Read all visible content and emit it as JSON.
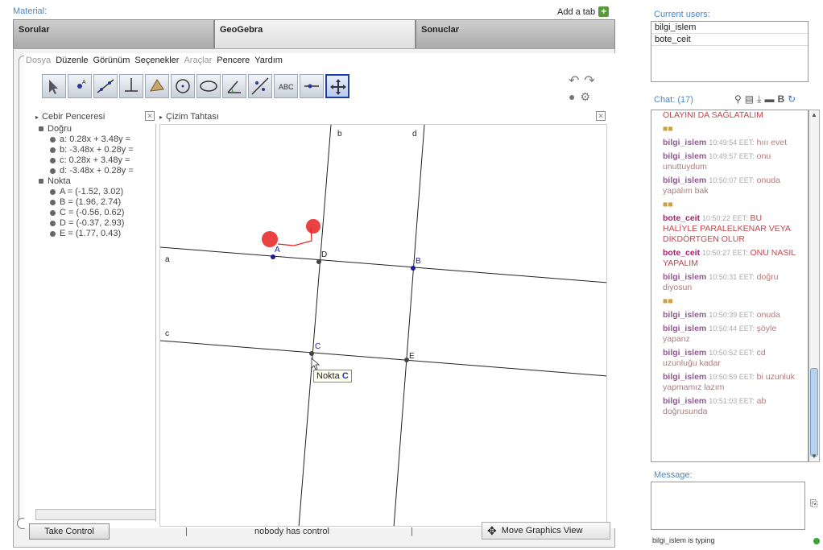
{
  "material": {
    "label": "Material:",
    "add_tab": "Add a tab",
    "tabs": [
      {
        "label": "Sorular"
      },
      {
        "label": "GeoGebra"
      },
      {
        "label": "Sonuclar"
      }
    ]
  },
  "geogebra": {
    "menu": [
      "Dosya",
      "Düzenle",
      "Görünüm",
      "Seçenekler",
      "Araçlar",
      "Pencere",
      "Yardım"
    ],
    "algebra_view": {
      "title": "Cebir Penceresi",
      "categories": [
        {
          "label": "Doğru",
          "items": [
            "a: 0.28x + 3.48y =",
            "b: -3.48x + 0.28y =",
            "c: 0.28x + 3.48y =",
            "d: -3.48x + 0.28y ="
          ]
        },
        {
          "label": "Nokta",
          "items": [
            "A = (-1.52, 3.02)",
            "B = (1.96, 2.74)",
            "C = (-0.56, 0.62)",
            "D = (-0.37, 2.93)",
            "E = (1.77, 0.43)"
          ]
        }
      ]
    },
    "graphics_view": {
      "title": "Çizim Tahtası",
      "line_labels": {
        "a": "a",
        "b": "b",
        "c": "c",
        "d": "d"
      },
      "point_labels": {
        "A": "A",
        "B": "B",
        "C": "C",
        "D": "D",
        "E": "E"
      },
      "tooltip_prefix": "Nokta",
      "tooltip_point": "C"
    },
    "status": {
      "take_control": "Take Control",
      "control_text": "nobody has control",
      "move_graphics": "Move Graphics View",
      "separator": "|"
    }
  },
  "users": {
    "label": "Current users:",
    "list": [
      "bilgi_islem",
      "bote_ceit"
    ]
  },
  "chat": {
    "label": "Chat: (17)",
    "messages": [
      {
        "type": "shout",
        "text": "OLAYINI DA SAĞLATALIM"
      },
      {
        "type": "sys",
        "text": "■■"
      },
      {
        "who": "bilgi_islem",
        "time": "10:49:54 EET:",
        "text": "hııı evet"
      },
      {
        "who": "bilgi_islem",
        "time": "10:49:57 EET:",
        "text": "onu unuttuydum"
      },
      {
        "who": "bilgi_islem",
        "time": "10:50:07 EET:",
        "text": "onuda yapalım bak"
      },
      {
        "type": "sys",
        "text": "■■"
      },
      {
        "who": "bote_ceit",
        "time": "10:50:22 EET:",
        "text": "BU HALİYLE PARALELKENAR VEYA DİKDÖRTGEN OLUR"
      },
      {
        "who": "bote_ceit",
        "time": "10:50:27 EET:",
        "text": "ONU NASIL YAPALIM"
      },
      {
        "who": "bilgi_islem",
        "time": "10:50:31 EET:",
        "text": "doğru diyosun"
      },
      {
        "type": "sys",
        "text": "■■"
      },
      {
        "who": "bilgi_islem",
        "time": "10:50:39 EET:",
        "text": "onuda"
      },
      {
        "who": "bilgi_islem",
        "time": "10:50:44 EET:",
        "text": "şöyle yapanz"
      },
      {
        "who": "bilgi_islem",
        "time": "10:50:52 EET:",
        "text": "cd uzunluğu kadar"
      },
      {
        "who": "bilgi_islem",
        "time": "10:50:59 EET:",
        "text": "bi uzunluk yapmamız lazım"
      },
      {
        "who": "bilgi_islem",
        "time": "10:51:03 EET:",
        "text": "ab doğrusunda"
      }
    ]
  },
  "message": {
    "label": "Message:",
    "typing": "bilgi_islem is typing"
  },
  "colors": {
    "accent_blue": "#4a86c8",
    "point_blue": "#1a1a9a",
    "cursor_red": "#e62020",
    "online_green": "#3aa33a"
  }
}
